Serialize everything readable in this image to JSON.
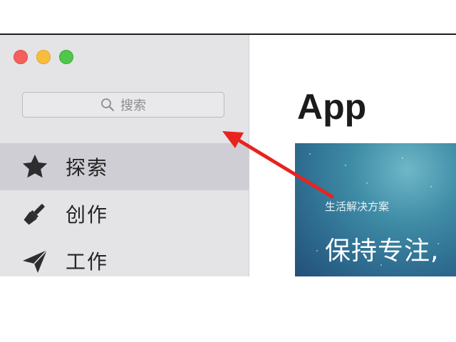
{
  "window": {
    "controls": [
      "close",
      "minimize",
      "maximize"
    ]
  },
  "search": {
    "icon": "search-icon",
    "placeholder": "搜索"
  },
  "sidebar": {
    "items": [
      {
        "label": "探索",
        "icon": "star-icon",
        "selected": true
      },
      {
        "label": "创作",
        "icon": "brush-icon",
        "selected": false
      },
      {
        "label": "工作",
        "icon": "paper-plane-icon",
        "selected": false
      }
    ]
  },
  "main": {
    "title": "App",
    "banner": {
      "subtitle": "生活解决方案",
      "headline": "保持专注,"
    }
  },
  "annotation": {
    "arrow_color": "#e8231f"
  }
}
